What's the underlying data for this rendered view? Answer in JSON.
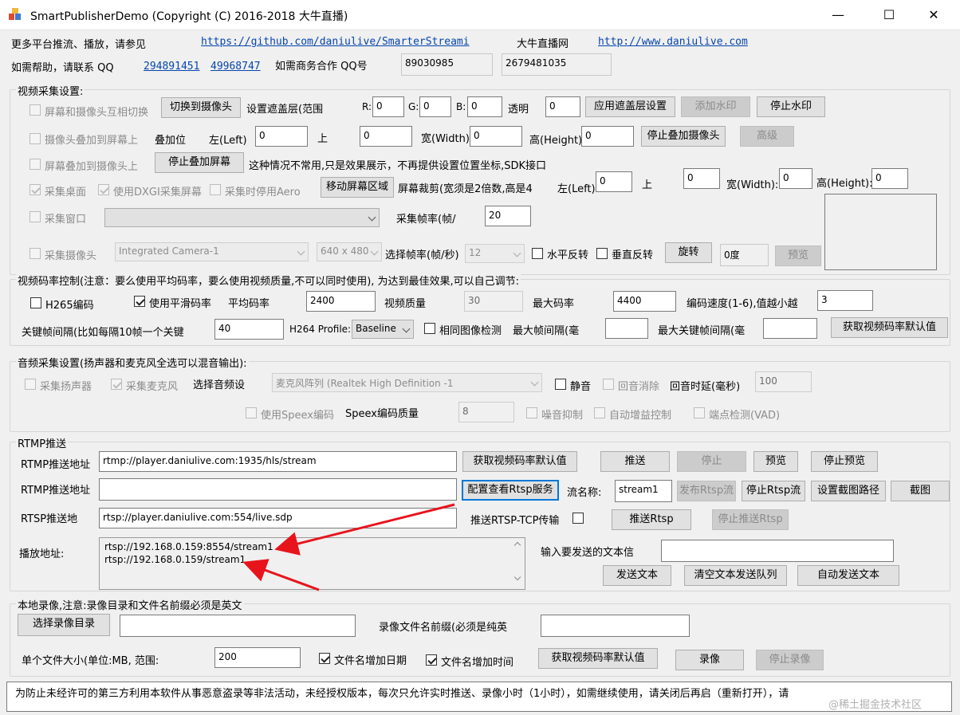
{
  "window": {
    "title": "SmartPublisherDemo  (Copyright (C) 2016-2018 大牛直播)",
    "minimize": "—",
    "maximize": "☐",
    "close": "✕"
  },
  "header": {
    "more_platforms": "更多平台推流、播放，请参见",
    "github_link": "https://github.com/daniulive/SmarterStreami",
    "site_name": "大牛直播网",
    "site_link": "http://www.daniulive.com",
    "help_contact": "如需帮助，请联系 QQ",
    "qq1": "294891451",
    "qq2": "49968747",
    "business_qq_label": "如需商务合作 QQ号",
    "business_qq1": "89030985",
    "business_qq2": "2679481035"
  },
  "video_capture": {
    "group_label": "视频采集设置:",
    "row1": {
      "switch_cb": "屏幕和摄像头互相切换",
      "switch_btn": "切换到摄像头",
      "mask_label": "设置遮盖层(范围",
      "r_label": "R:",
      "r": "0",
      "g_label": "G:",
      "g": "0",
      "b_label": "B:",
      "b": "0",
      "alpha_label": "透明",
      "alpha": "0",
      "apply_btn": "应用遮盖层设置",
      "add_wm_btn": "添加水印",
      "stop_wm_btn": "停止水印"
    },
    "row2": {
      "cam_on_screen_cb": "摄像头叠加到屏幕上",
      "overlay_pos": "叠加位",
      "left_label": "左(Left)",
      "left": "0",
      "top_label": "上",
      "top": "0",
      "width_label": "宽(Width)",
      "width": "0",
      "height_label": "高(Height)",
      "height": "0",
      "stop_cam_btn": "停止叠加摄像头",
      "advanced_btn": "高级"
    },
    "row3": {
      "screen_on_cam_cb": "屏幕叠加到摄像头上",
      "stop_screen_btn": "停止叠加屏幕",
      "note": "这种情况不常用,只是效果展示，不再提供设置位置坐标,SDK接口"
    },
    "row4": {
      "desktop_cb": "采集桌面",
      "dxgi_cb": "使用DXGI采集屏幕",
      "aero_cb": "采集时停用Aero",
      "move_btn": "移动屏幕区域",
      "crop_label": "屏幕裁剪(宽须是2倍数,高是4",
      "left_label": "左(Left):",
      "left": "0",
      "top_label": "上",
      "top": "0",
      "width_label": "宽(Width):",
      "width": "0",
      "height_label": "高(Height):",
      "height": "0"
    },
    "row5": {
      "window_cb": "采集窗口",
      "window_select": "",
      "fps_label": "采集帧率(帧/",
      "fps": "20"
    },
    "row6": {
      "camera_cb": "采集摄像头",
      "camera_select": "Integrated Camera-1",
      "res_select": "640 x 480",
      "fps_label": "选择帧率(帧/秒)",
      "fps_select": "12",
      "hflip_cb": "水平反转",
      "vflip_cb": "垂直反转",
      "rotate_btn": "旋转",
      "rotate_value": "0度",
      "preview_btn": "预览"
    }
  },
  "bitrate": {
    "group_label": "视频码率控制(注意：要么使用平均码率，要么使用视频质量,不可以同时使用), 为达到最佳效果,可以自己调节:",
    "h265_cb": "H265编码",
    "avg_cb": "使用平滑码率",
    "avg_label": "平均码率",
    "avg": "2400",
    "quality_label": "视频质量",
    "quality": "30",
    "max_label": "最大码率",
    "max": "4400",
    "speed_label": "编码速度(1-6),值越小越",
    "speed": "3",
    "keyframe_label": "关键帧间隔(比如每隔10帧一个关键",
    "keyframe": "40",
    "profile_label": "H264 Profile:",
    "profile": "Baseline",
    "same_cb": "相同图像检测",
    "max_frame_label": "最大帧间隔(毫",
    "max_frame": "",
    "max_key_label": "最大关键帧间隔(毫",
    "max_key": "",
    "default_btn": "获取视频码率默认值"
  },
  "audio": {
    "group_label": "音频采集设置(扬声器和麦克风全选可以混音输出):",
    "speaker_cb": "采集扬声器",
    "mic_cb": "采集麦克风",
    "device_label": "选择音频设",
    "device": "麦克风阵列 (Realtek High Definition -1",
    "mute_cb": "静音",
    "echo_cb": "回音消除",
    "echo_delay_label": "回音时延(毫秒)",
    "echo_delay": "100",
    "speex_cb": "使用Speex编码",
    "speex_quality_label": "Speex编码质量",
    "speex_quality": "8",
    "noise_cb": "噪音抑制",
    "agc_cb": "自动增益控制",
    "vad_cb": "端点检测(VAD)"
  },
  "rtmp": {
    "group_label": "RTMP推送",
    "url1_label": "RTMP推送地址",
    "url1": "rtmp://player.daniulive.com:1935/hls/stream",
    "get_default_btn": "获取视频码率默认值",
    "push_btn": "推送",
    "stop_btn": "停止",
    "preview_btn": "预览",
    "stop_preview_btn": "停止预览",
    "url2_label": "RTMP推送地址",
    "url2": "",
    "rtsp_config_btn": "配置查看Rtsp服务",
    "stream_label": "流名称:",
    "stream_name": "stream1",
    "publish_rtsp_btn": "发布Rtsp流",
    "stop_rtsp_btn": "停止Rtsp流",
    "snapshot_path_btn": "设置截图路径",
    "snapshot_btn": "截图",
    "rtsp_label": "RTSP推送地",
    "rtsp_url": "rtsp://player.daniulive.com:554/live.sdp",
    "tcp_label": "推送RTSP-TCP传输",
    "push_rtsp_btn": "推送Rtsp",
    "stop_push_rtsp_btn": "停止推送Rtsp",
    "play_label": "播放地址:",
    "play_urls": [
      "rtsp://192.168.0.159:8554/stream1",
      "rtsp://192.168.0.159/stream1"
    ],
    "text_label": "输入要发送的文本信",
    "text_input": "",
    "send_text_btn": "发送文本",
    "clear_queue_btn": "清空文本发送队列",
    "auto_send_btn": "自动发送文本"
  },
  "record": {
    "group_label": "本地录像,注意:录像目录和文件名前缀必须是英文",
    "dir_btn": "选择录像目录",
    "dir": "",
    "prefix_label": "录像文件名前缀(必须是纯英",
    "prefix": "",
    "size_label": "单个文件大小(单位:MB, 范围:",
    "size": "200",
    "date_cb": "文件名增加日期",
    "time_cb": "文件名增加时间",
    "default_btn": "获取视频码率默认值",
    "record_btn": "录像",
    "stop_btn": "停止录像"
  },
  "footer": {
    "notice": "为防止未经许可的第三方利用本软件从事恶意盗录等非法活动，未经授权版本，每次只允许实时推送、录像小时（1小时），如需继续使用，请关闭后再启（重新打开），请",
    "watermark": "@稀土掘金技术社区"
  },
  "colors": {
    "link": "#0645ad",
    "arrow": "#e8141c",
    "focus": "#0078d7"
  }
}
